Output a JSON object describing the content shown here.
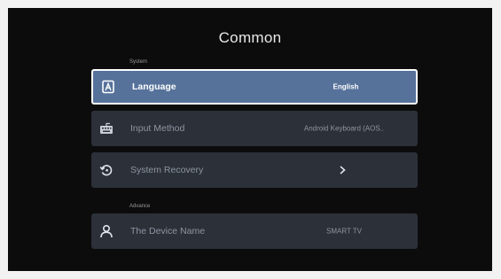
{
  "screen": {
    "title": "Common"
  },
  "sections": {
    "system_label": "System",
    "advance_label": "Advance"
  },
  "rows": [
    {
      "label": "Language",
      "value": "English",
      "icon": "language-icon",
      "focused": true
    },
    {
      "label": "Input Method",
      "value": "Android Keyboard (AOS..",
      "icon": "keyboard-icon",
      "focused": false
    },
    {
      "label": "System Recovery",
      "value": "",
      "icon": "restore-icon",
      "focused": false,
      "trailing": "chevron-right-icon"
    },
    {
      "label": "The Device Name",
      "value": "SMART TV",
      "icon": "person-icon",
      "focused": false
    }
  ],
  "colors": {
    "background": "#0c0c0c",
    "row": "#2b3039",
    "row_focused": "#56729a",
    "focus_border": "#ffffff"
  }
}
